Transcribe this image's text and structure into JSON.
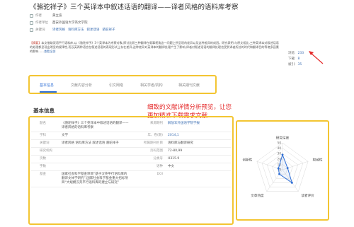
{
  "title": "《骆驼祥子》三个英译本中叙述话语的翻译——译者风格的语料库考察",
  "meta": {
    "author_label": "作者",
    "author": "黄立波",
    "org_label": "作者单位",
    "org": "西安外国语大学英文学院",
    "keywords_label": "关键词",
    "keywords": [
      "译者风格",
      "语料库方法",
      "叙述话语",
      "骆驼祥子"
    ]
  },
  "abstract": {
    "label": "【摘要】",
    "text": "本文借助双语平行语料库,以《骆驼祥子》3个英译本为考察对象,探讨比照三种翻译在叙事视角这一问题上所呈现的差异以及这种差异的成因。研究表明:与原文相比,三种英译本对叙述话语的处理都呈现出明显的规律性,而汉英两种语言在叙述话语的表现形式上存在差异,这种差异对英译本的翻译处理产生了影响,译者对叙述话语的翻译处理也受到译者所处的时代和翻译目的等诸多因素的影响......",
    "more": "查看全部"
  },
  "stats": {
    "views_label": "浏览:",
    "views": "233",
    "downloads_label": "下载:",
    "downloads": "8",
    "cites_label": "被引:",
    "cites": "35"
  },
  "tabs": [
    "基本信息",
    "文献内容分析",
    "引文网络",
    "相关学者/机构",
    "相关期刊文献"
  ],
  "section_title": "基本信息",
  "promo_text": "细致的文献详情分析预览，让您更加精准下载需求文献",
  "info_rows": [
    {
      "k1": "题名",
      "v1": "《骆驼祥子》三个英译本中叙述话语的翻译——译者风格的语料库考察",
      "k2": "来源期刊",
      "v2": "解放军外国语学院学报",
      "link": true
    },
    {
      "k1": "学科",
      "v1": "文学",
      "k2": "年、卷(期)",
      "v2": "2014,1",
      "link": true
    },
    {
      "k1": "关键词",
      "v1": "译者风格 语料库方法 叙述话语 骆驼祥子",
      "k2": "所属期刊栏目",
      "v2": "语料库与翻译研究",
      "link": false
    },
    {
      "k1": "研究机构",
      "v1": "",
      "k2": "页码范围",
      "v2": "72-80,99",
      "link": false
    },
    {
      "k1": "页数",
      "v1": "",
      "k2": "分类号",
      "v2": "H315.9",
      "link": false
    },
    {
      "k1": "字数",
      "v1": "",
      "k2": "语种",
      "v2": "中文",
      "link": false
    },
    {
      "k1": "基金",
      "v1": "国家社会科学基金项目“基于汉英平行语料库的翻译文体学研究”,国家社会科学基金重大招标项目“大规模汉英平行语料库的建立与研究”",
      "k2": "DOI",
      "v2": "",
      "link": false
    }
  ],
  "radar": {
    "axes": [
      "研究深度",
      "权威性",
      "读者评价",
      "文章热度",
      "创新性"
    ],
    "ticks": [
      "50",
      "40",
      "30",
      "20",
      "10",
      "0"
    ],
    "values": [
      28,
      10,
      30,
      10,
      8
    ]
  },
  "colors": {
    "accent_blue": "#2f6fd6",
    "highlight_yellow": "#f3c532",
    "promo_red": "#e52b2b"
  }
}
